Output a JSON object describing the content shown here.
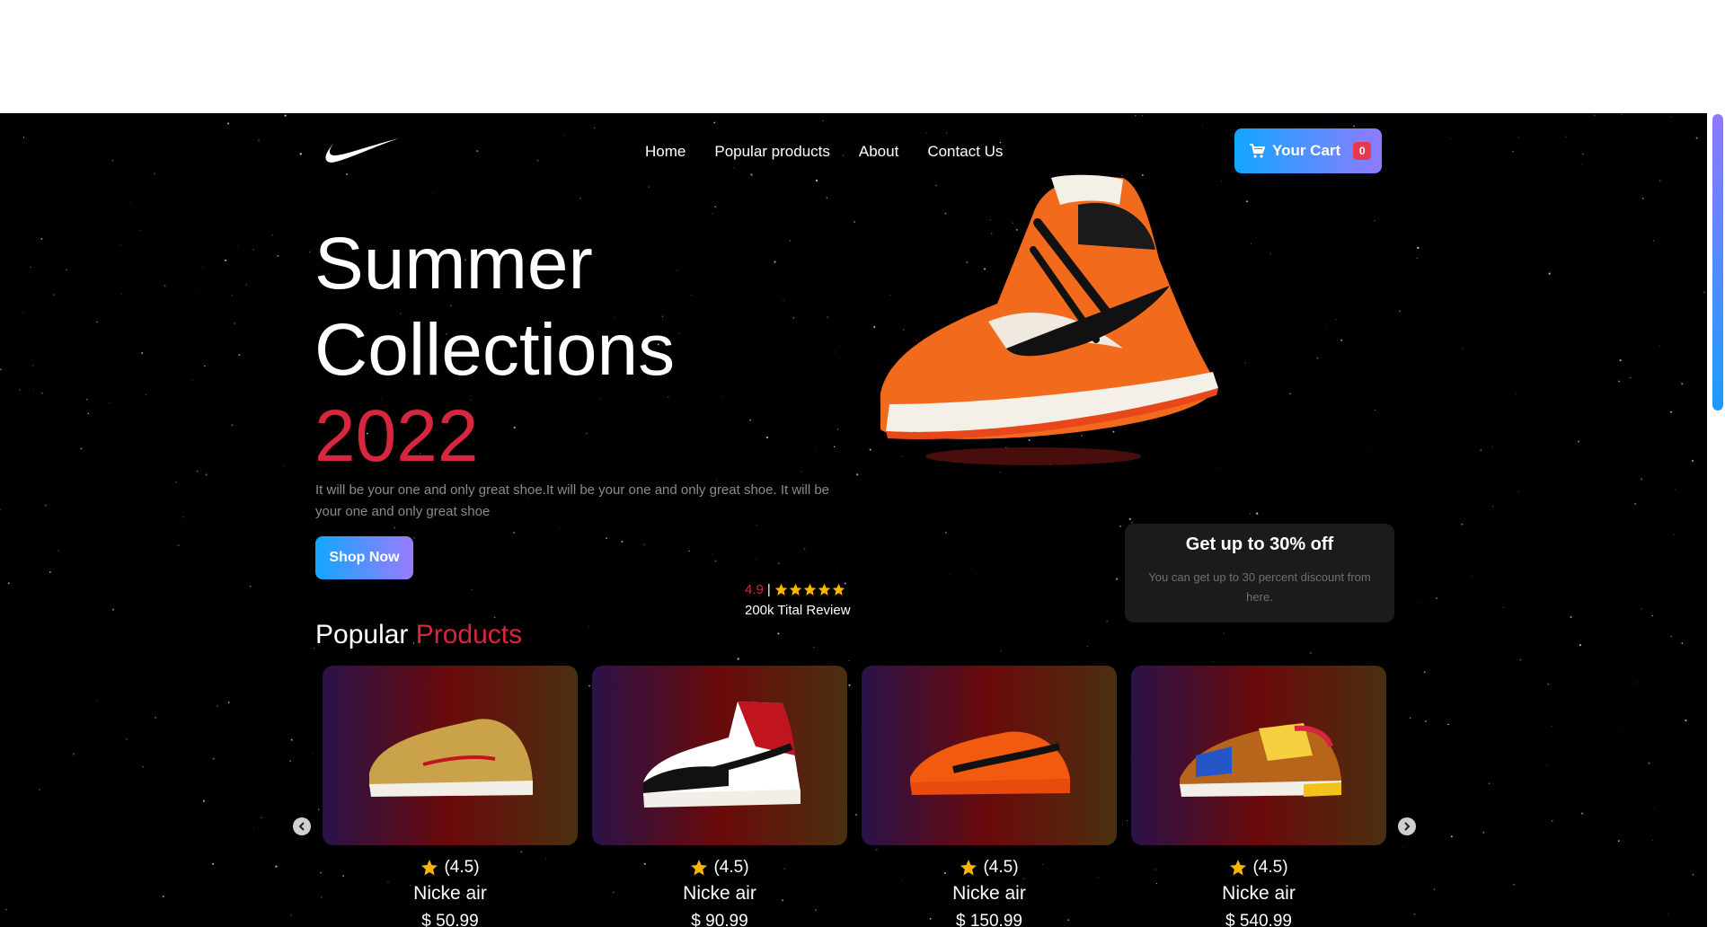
{
  "nav": {
    "links": [
      "Home",
      "Popular products",
      "About",
      "Contact Us"
    ],
    "cart_label": "Your Cart",
    "cart_count": "0"
  },
  "hero": {
    "title_line1": "Summer",
    "title_line2": "Collections",
    "year": "2022",
    "description": "It will be your one and only great shoe.It will be your one and only great shoe. It will be your one and only great shoe",
    "cta": "Shop Now"
  },
  "rating": {
    "score": "4.9",
    "separator": "|",
    "stars": 5,
    "label": "200k Tital Review"
  },
  "discount": {
    "title": "Get up to 30% off",
    "subtitle": "You can get up to 30 percent discount from here."
  },
  "popular": {
    "title_white": "Popular",
    "title_accent": "Products",
    "items": [
      {
        "rating": "(4.5)",
        "name": "Nicke air",
        "price": "$ 50.99"
      },
      {
        "rating": "(4.5)",
        "name": "Nicke air",
        "price": "$ 90.99"
      },
      {
        "rating": "(4.5)",
        "name": "Nicke air",
        "price": "$ 150.99"
      },
      {
        "rating": "(4.5)",
        "name": "Nicke air",
        "price": "$ 540.99"
      }
    ]
  },
  "colors": {
    "accent": "#d7263d",
    "button_from": "#12a6ff",
    "button_to": "#8f7bff",
    "star": "#f5b400"
  }
}
